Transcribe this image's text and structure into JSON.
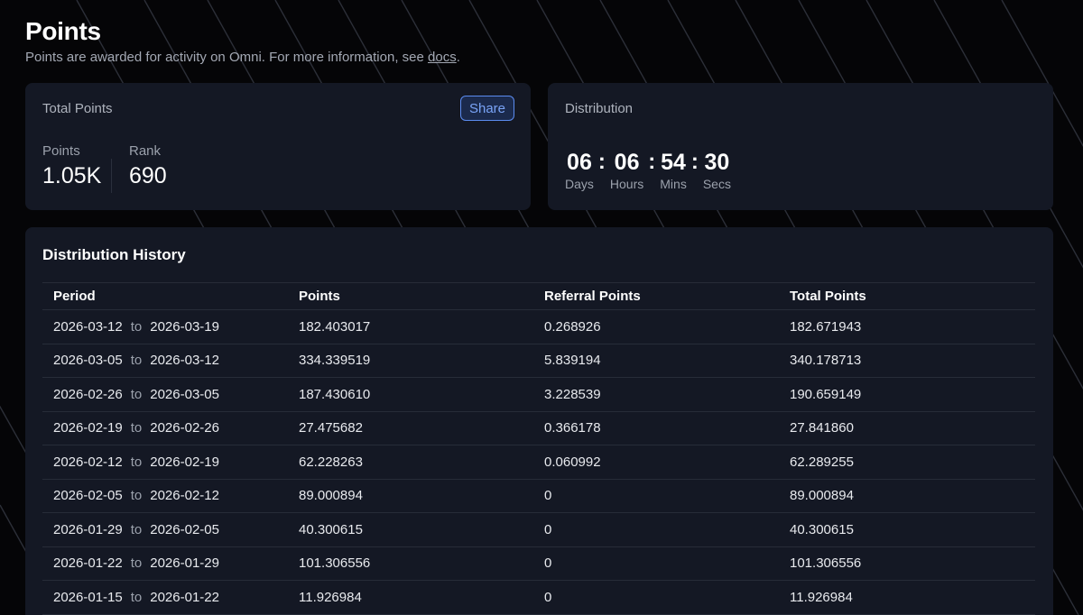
{
  "page": {
    "title": "Points",
    "subtitle_prefix": "Points are awarded for activity on Omni. For more information, see ",
    "subtitle_link": "docs",
    "subtitle_suffix": "."
  },
  "total_points": {
    "label": "Total Points",
    "share_label": "Share",
    "points_label": "Points",
    "points_value": "1.05K",
    "rank_label": "Rank",
    "rank_value": "690"
  },
  "distribution": {
    "label": "Distribution",
    "separator": ":",
    "countdown": [
      {
        "value": "06",
        "unit": "Days"
      },
      {
        "value": "06",
        "unit": "Hours"
      },
      {
        "value": "54",
        "unit": "Mins"
      },
      {
        "value": "30",
        "unit": "Secs"
      }
    ]
  },
  "history": {
    "title": "Distribution History",
    "period_connector": "to",
    "columns": [
      "Period",
      "Points",
      "Referral Points",
      "Total Points"
    ],
    "rows": [
      {
        "start": "2026-03-12",
        "end": "2026-03-19",
        "points": "182.403017",
        "referral": "0.268926",
        "total": "182.671943"
      },
      {
        "start": "2026-03-05",
        "end": "2026-03-12",
        "points": "334.339519",
        "referral": "5.839194",
        "total": "340.178713"
      },
      {
        "start": "2026-02-26",
        "end": "2026-03-05",
        "points": "187.430610",
        "referral": "3.228539",
        "total": "190.659149"
      },
      {
        "start": "2026-02-19",
        "end": "2026-02-26",
        "points": "27.475682",
        "referral": "0.366178",
        "total": "27.841860"
      },
      {
        "start": "2026-02-12",
        "end": "2026-02-19",
        "points": "62.228263",
        "referral": "0.060992",
        "total": "62.289255"
      },
      {
        "start": "2026-02-05",
        "end": "2026-02-12",
        "points": "89.000894",
        "referral": "0",
        "total": "89.000894"
      },
      {
        "start": "2026-01-29",
        "end": "2026-02-05",
        "points": "40.300615",
        "referral": "0",
        "total": "40.300615"
      },
      {
        "start": "2026-01-22",
        "end": "2026-01-29",
        "points": "101.306556",
        "referral": "0",
        "total": "101.306556"
      },
      {
        "start": "2026-01-15",
        "end": "2026-01-22",
        "points": "11.926984",
        "referral": "0",
        "total": "11.926984"
      }
    ]
  },
  "colors": {
    "background": "#050507",
    "card": "#141824",
    "accent": "#5b8cf0",
    "muted_text": "#9ba1ac"
  }
}
